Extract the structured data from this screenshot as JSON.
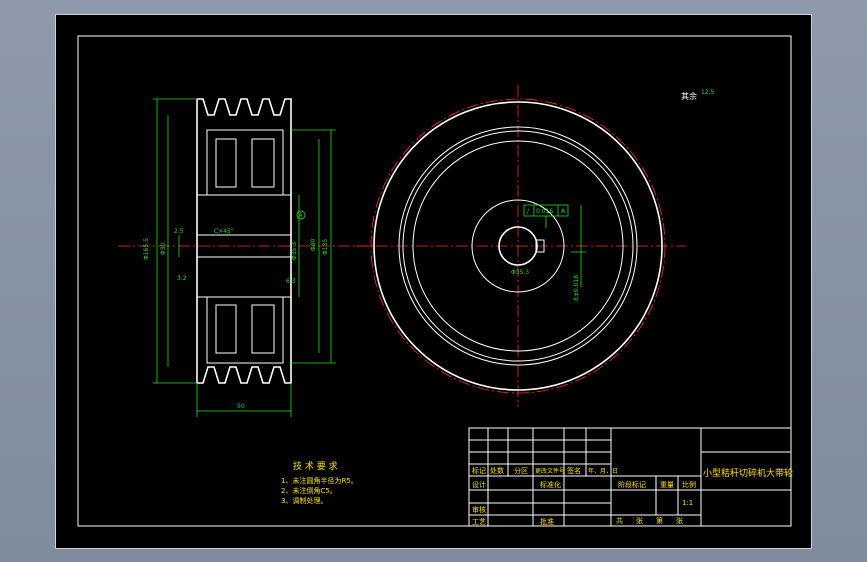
{
  "drawing": {
    "title": "小型秸秆切碎机大带轮",
    "roughness_note": "其余",
    "roughness_value": "12.5",
    "width_dim": "50",
    "dia_outer": "Φ165.5",
    "dia_mid": "Φ135",
    "dia_pulley": "Φ80",
    "dia_hub": "Φ30",
    "dia_bore": "Φ30",
    "keyway_dim": "Φ35.3",
    "chamfer": "C×45°",
    "tol_frame": "0.016",
    "datum": "A",
    "key_width": "8±0.018",
    "dim_small": "2.5",
    "datum_marker": "A",
    "roughness_small": "6.3",
    "roughness_small2": "3.2"
  },
  "notes": {
    "heading": "技 术 要 求",
    "lines": [
      "1、未注圆角半径为R5。",
      "2、未注倒角C5。",
      "3、调制处理。"
    ]
  },
  "title_block": {
    "r1": [
      "标记",
      "处数",
      "分区",
      "更改文件号",
      "签名",
      "年、月、日"
    ],
    "design": "设计",
    "standard": "标准化",
    "stage": "阶段标记",
    "weight": "重量",
    "ratio": "比例",
    "scale": "1:1",
    "review": "审核",
    "process": "工艺",
    "approve": "批准",
    "sheets": [
      "共",
      "张",
      "第",
      "张"
    ]
  }
}
